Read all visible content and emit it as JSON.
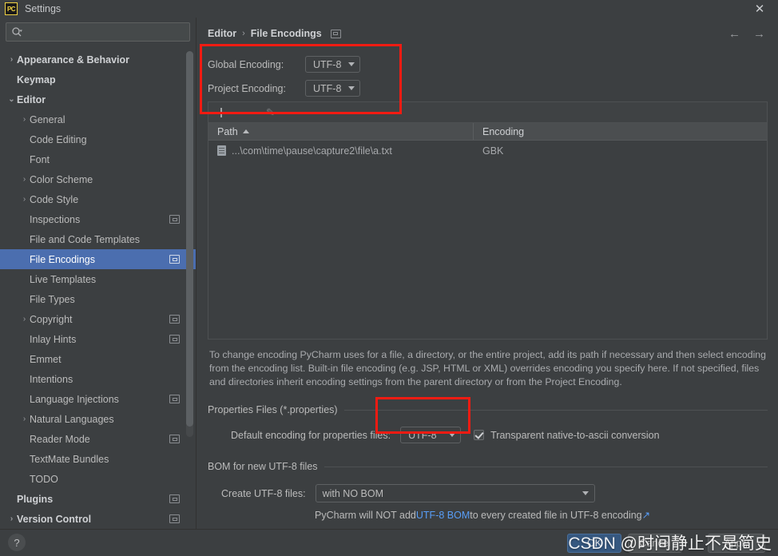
{
  "window": {
    "title": "Settings",
    "app_badge": "PC",
    "close_icon": "✕"
  },
  "sidebar": {
    "search": {
      "value": "",
      "placeholder": ""
    },
    "items": [
      {
        "label": "Appearance & Behavior",
        "twisty": "›",
        "level": 0,
        "bold": true,
        "selected": false,
        "badge": false
      },
      {
        "label": "Keymap",
        "twisty": "",
        "level": 0,
        "bold": true,
        "selected": false,
        "badge": false
      },
      {
        "label": "Editor",
        "twisty": "⌄",
        "level": 0,
        "bold": true,
        "selected": false,
        "badge": false
      },
      {
        "label": "General",
        "twisty": "›",
        "level": 1,
        "bold": false,
        "selected": false,
        "badge": false
      },
      {
        "label": "Code Editing",
        "twisty": "",
        "level": 1,
        "bold": false,
        "selected": false,
        "badge": false
      },
      {
        "label": "Font",
        "twisty": "",
        "level": 1,
        "bold": false,
        "selected": false,
        "badge": false
      },
      {
        "label": "Color Scheme",
        "twisty": "›",
        "level": 1,
        "bold": false,
        "selected": false,
        "badge": false
      },
      {
        "label": "Code Style",
        "twisty": "›",
        "level": 1,
        "bold": false,
        "selected": false,
        "badge": false
      },
      {
        "label": "Inspections",
        "twisty": "",
        "level": 1,
        "bold": false,
        "selected": false,
        "badge": true
      },
      {
        "label": "File and Code Templates",
        "twisty": "",
        "level": 1,
        "bold": false,
        "selected": false,
        "badge": false
      },
      {
        "label": "File Encodings",
        "twisty": "",
        "level": 1,
        "bold": false,
        "selected": true,
        "badge": true
      },
      {
        "label": "Live Templates",
        "twisty": "",
        "level": 1,
        "bold": false,
        "selected": false,
        "badge": false
      },
      {
        "label": "File Types",
        "twisty": "",
        "level": 1,
        "bold": false,
        "selected": false,
        "badge": false
      },
      {
        "label": "Copyright",
        "twisty": "›",
        "level": 1,
        "bold": false,
        "selected": false,
        "badge": true
      },
      {
        "label": "Inlay Hints",
        "twisty": "",
        "level": 1,
        "bold": false,
        "selected": false,
        "badge": true
      },
      {
        "label": "Emmet",
        "twisty": "",
        "level": 1,
        "bold": false,
        "selected": false,
        "badge": false
      },
      {
        "label": "Intentions",
        "twisty": "",
        "level": 1,
        "bold": false,
        "selected": false,
        "badge": false
      },
      {
        "label": "Language Injections",
        "twisty": "",
        "level": 1,
        "bold": false,
        "selected": false,
        "badge": true
      },
      {
        "label": "Natural Languages",
        "twisty": "›",
        "level": 1,
        "bold": false,
        "selected": false,
        "badge": false
      },
      {
        "label": "Reader Mode",
        "twisty": "",
        "level": 1,
        "bold": false,
        "selected": false,
        "badge": true
      },
      {
        "label": "TextMate Bundles",
        "twisty": "",
        "level": 1,
        "bold": false,
        "selected": false,
        "badge": false
      },
      {
        "label": "TODO",
        "twisty": "",
        "level": 1,
        "bold": false,
        "selected": false,
        "badge": false
      },
      {
        "label": "Plugins",
        "twisty": "",
        "level": 0,
        "bold": true,
        "selected": false,
        "badge": true
      },
      {
        "label": "Version Control",
        "twisty": "›",
        "level": 0,
        "bold": true,
        "selected": false,
        "badge": true
      }
    ]
  },
  "breadcrumb": {
    "parent": "Editor",
    "separator": "›",
    "current": "File Encodings"
  },
  "nav": {
    "back": "←",
    "forward": "→"
  },
  "encodings": {
    "global_label": "Global Encoding:",
    "global_value": "UTF-8",
    "project_label": "Project Encoding:",
    "project_value": "UTF-8"
  },
  "toolbar": {
    "add": "+",
    "remove": "−",
    "edit": "✎"
  },
  "table": {
    "columns": [
      "Path",
      "Encoding"
    ],
    "sort_column": "Path",
    "sort_direction": "asc",
    "rows": [
      {
        "path": "...\\com\\time\\pause\\capture2\\file\\a.txt",
        "encoding": "GBK"
      }
    ]
  },
  "hint": "To change encoding PyCharm uses for a file, a directory, or the entire project, add its path if necessary and then select encoding from the encoding list. Built-in file encoding (e.g. JSP, HTML or XML) overrides encoding you specify here. If not specified, files and directories inherit encoding settings from the parent directory or from the Project Encoding.",
  "properties_section": {
    "title": "Properties Files (*.properties)",
    "default_encoding_label": "Default encoding for properties files:",
    "default_encoding_value": "UTF-8",
    "transparent_label": "Transparent native-to-ascii conversion",
    "transparent_checked": true
  },
  "bom_section": {
    "title": "BOM for new UTF-8 files",
    "create_label": "Create UTF-8 files:",
    "create_value": "with NO BOM",
    "note_prefix": "PyCharm will NOT add ",
    "note_link": "UTF-8 BOM",
    "note_suffix": " to every created file in UTF-8 encoding ",
    "note_external_icon": "↗"
  },
  "bottom": {
    "help": "?",
    "ok": "OK",
    "cancel": "Cancel",
    "apply": "Apply"
  },
  "watermark": "CSDN @时间静止不是简史",
  "colors": {
    "background": "#3c3f41",
    "selection": "#4b6eaf",
    "annotation_red": "#f21b12",
    "link_blue": "#589df6",
    "primary_button": "#365880"
  }
}
